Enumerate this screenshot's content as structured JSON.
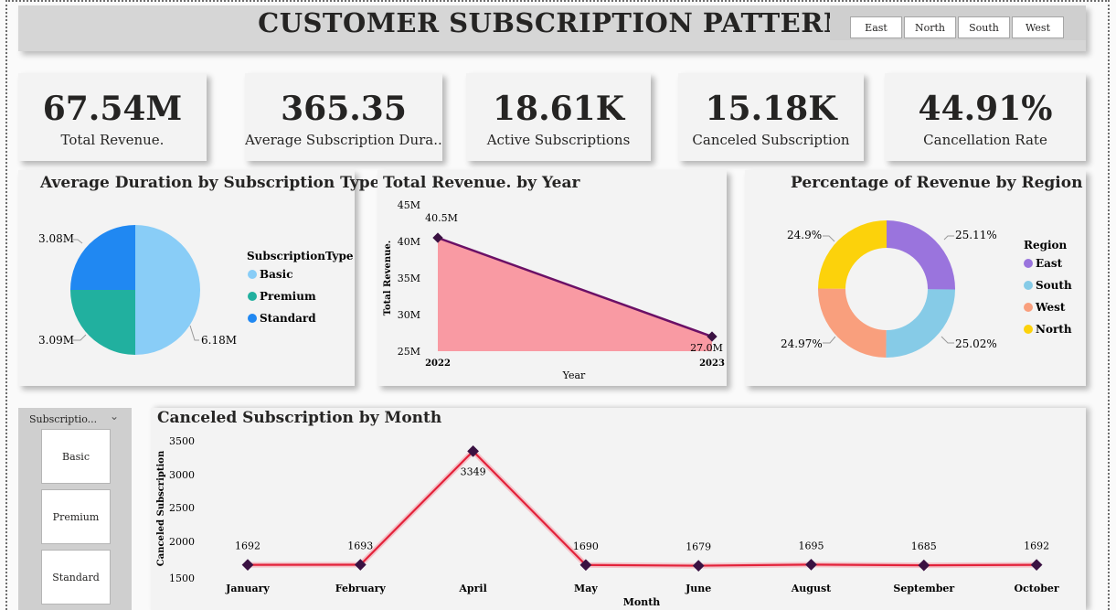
{
  "header": {
    "title": "CUSTOMER SUBSCRIPTION PATTERN"
  },
  "region_buttons": [
    "East",
    "North",
    "South",
    "West"
  ],
  "kpis": [
    {
      "value": "67.54M",
      "label": "Total Revenue."
    },
    {
      "value": "365.35",
      "label": "Average Subscription Dura..."
    },
    {
      "value": "18.61K",
      "label": "Active Subscriptions"
    },
    {
      "value": "15.18K",
      "label": "Canceled Subscription"
    },
    {
      "value": "44.91%",
      "label": "Cancellation Rate"
    }
  ],
  "pie_chart": {
    "title": "Average Duration by Subscription Type",
    "legend_title": "SubscriptionType",
    "legend": [
      "Basic",
      "Premium",
      "Standard"
    ],
    "labels": {
      "basic": "6.18M",
      "premium": "3.09M",
      "standard": "3.08M"
    }
  },
  "area_chart": {
    "title": "Total Revenue. by Year",
    "ylabel": "Total Revenue.",
    "xlabel": "Year",
    "yticks": [
      "45M",
      "40M",
      "35M",
      "30M",
      "25M"
    ],
    "xticks": [
      "2022",
      "2023"
    ],
    "data_labels": [
      "40.5M",
      "27.0M"
    ]
  },
  "donut_chart": {
    "title": "Percentage of Revenue by Region",
    "legend_title": "Region",
    "legend": [
      "East",
      "South",
      "West",
      "North"
    ],
    "labels": {
      "east": "25.11%",
      "south": "25.02%",
      "west": "24.97%",
      "north": "24.9%"
    }
  },
  "line_chart": {
    "title": "Canceled Subscription by Month",
    "ylabel": "Canceled Subscription",
    "xlabel": "Month",
    "yticks": [
      "3500",
      "3000",
      "2500",
      "2000",
      "1500"
    ]
  },
  "slicer": {
    "header": "Subscriptio...",
    "items": [
      "Basic",
      "Premium",
      "Standard"
    ]
  },
  "colors": {
    "basic": "#89cdf7",
    "premium": "#21b09f",
    "standard": "#2088f2",
    "east": "#9a74dd",
    "south": "#86cbe7",
    "west": "#f99f7d",
    "north": "#fcd20b",
    "area_fill": "#f99aa3",
    "area_line": "#6b1066",
    "line": "#e3223a",
    "marker": "#3a1142"
  },
  "chart_data": [
    {
      "type": "pie",
      "title": "Average Duration by Subscription Type",
      "categories": [
        "Basic",
        "Premium",
        "Standard"
      ],
      "values": [
        6.18,
        3.09,
        3.08
      ],
      "unit": "M",
      "legend": "right"
    },
    {
      "type": "area",
      "title": "Total Revenue. by Year",
      "x": [
        "2022",
        "2023"
      ],
      "values": [
        40.5,
        27.0
      ],
      "unit": "M",
      "xlabel": "Year",
      "ylabel": "Total Revenue.",
      "ylim": [
        25,
        45
      ]
    },
    {
      "type": "pie",
      "title": "Percentage of Revenue by Region",
      "categories": [
        "East",
        "South",
        "West",
        "North"
      ],
      "values": [
        25.11,
        25.02,
        24.97,
        24.9
      ],
      "unit": "%",
      "legend": "right"
    },
    {
      "type": "line",
      "title": "Canceled Subscription by Month",
      "categories": [
        "January",
        "February",
        "April",
        "May",
        "June",
        "August",
        "September",
        "October"
      ],
      "values": [
        1692,
        1693,
        3349,
        1690,
        1679,
        1695,
        1685,
        1692
      ],
      "xlabel": "Month",
      "ylabel": "Canceled Subscription",
      "ylim": [
        1500,
        3500
      ]
    }
  ]
}
